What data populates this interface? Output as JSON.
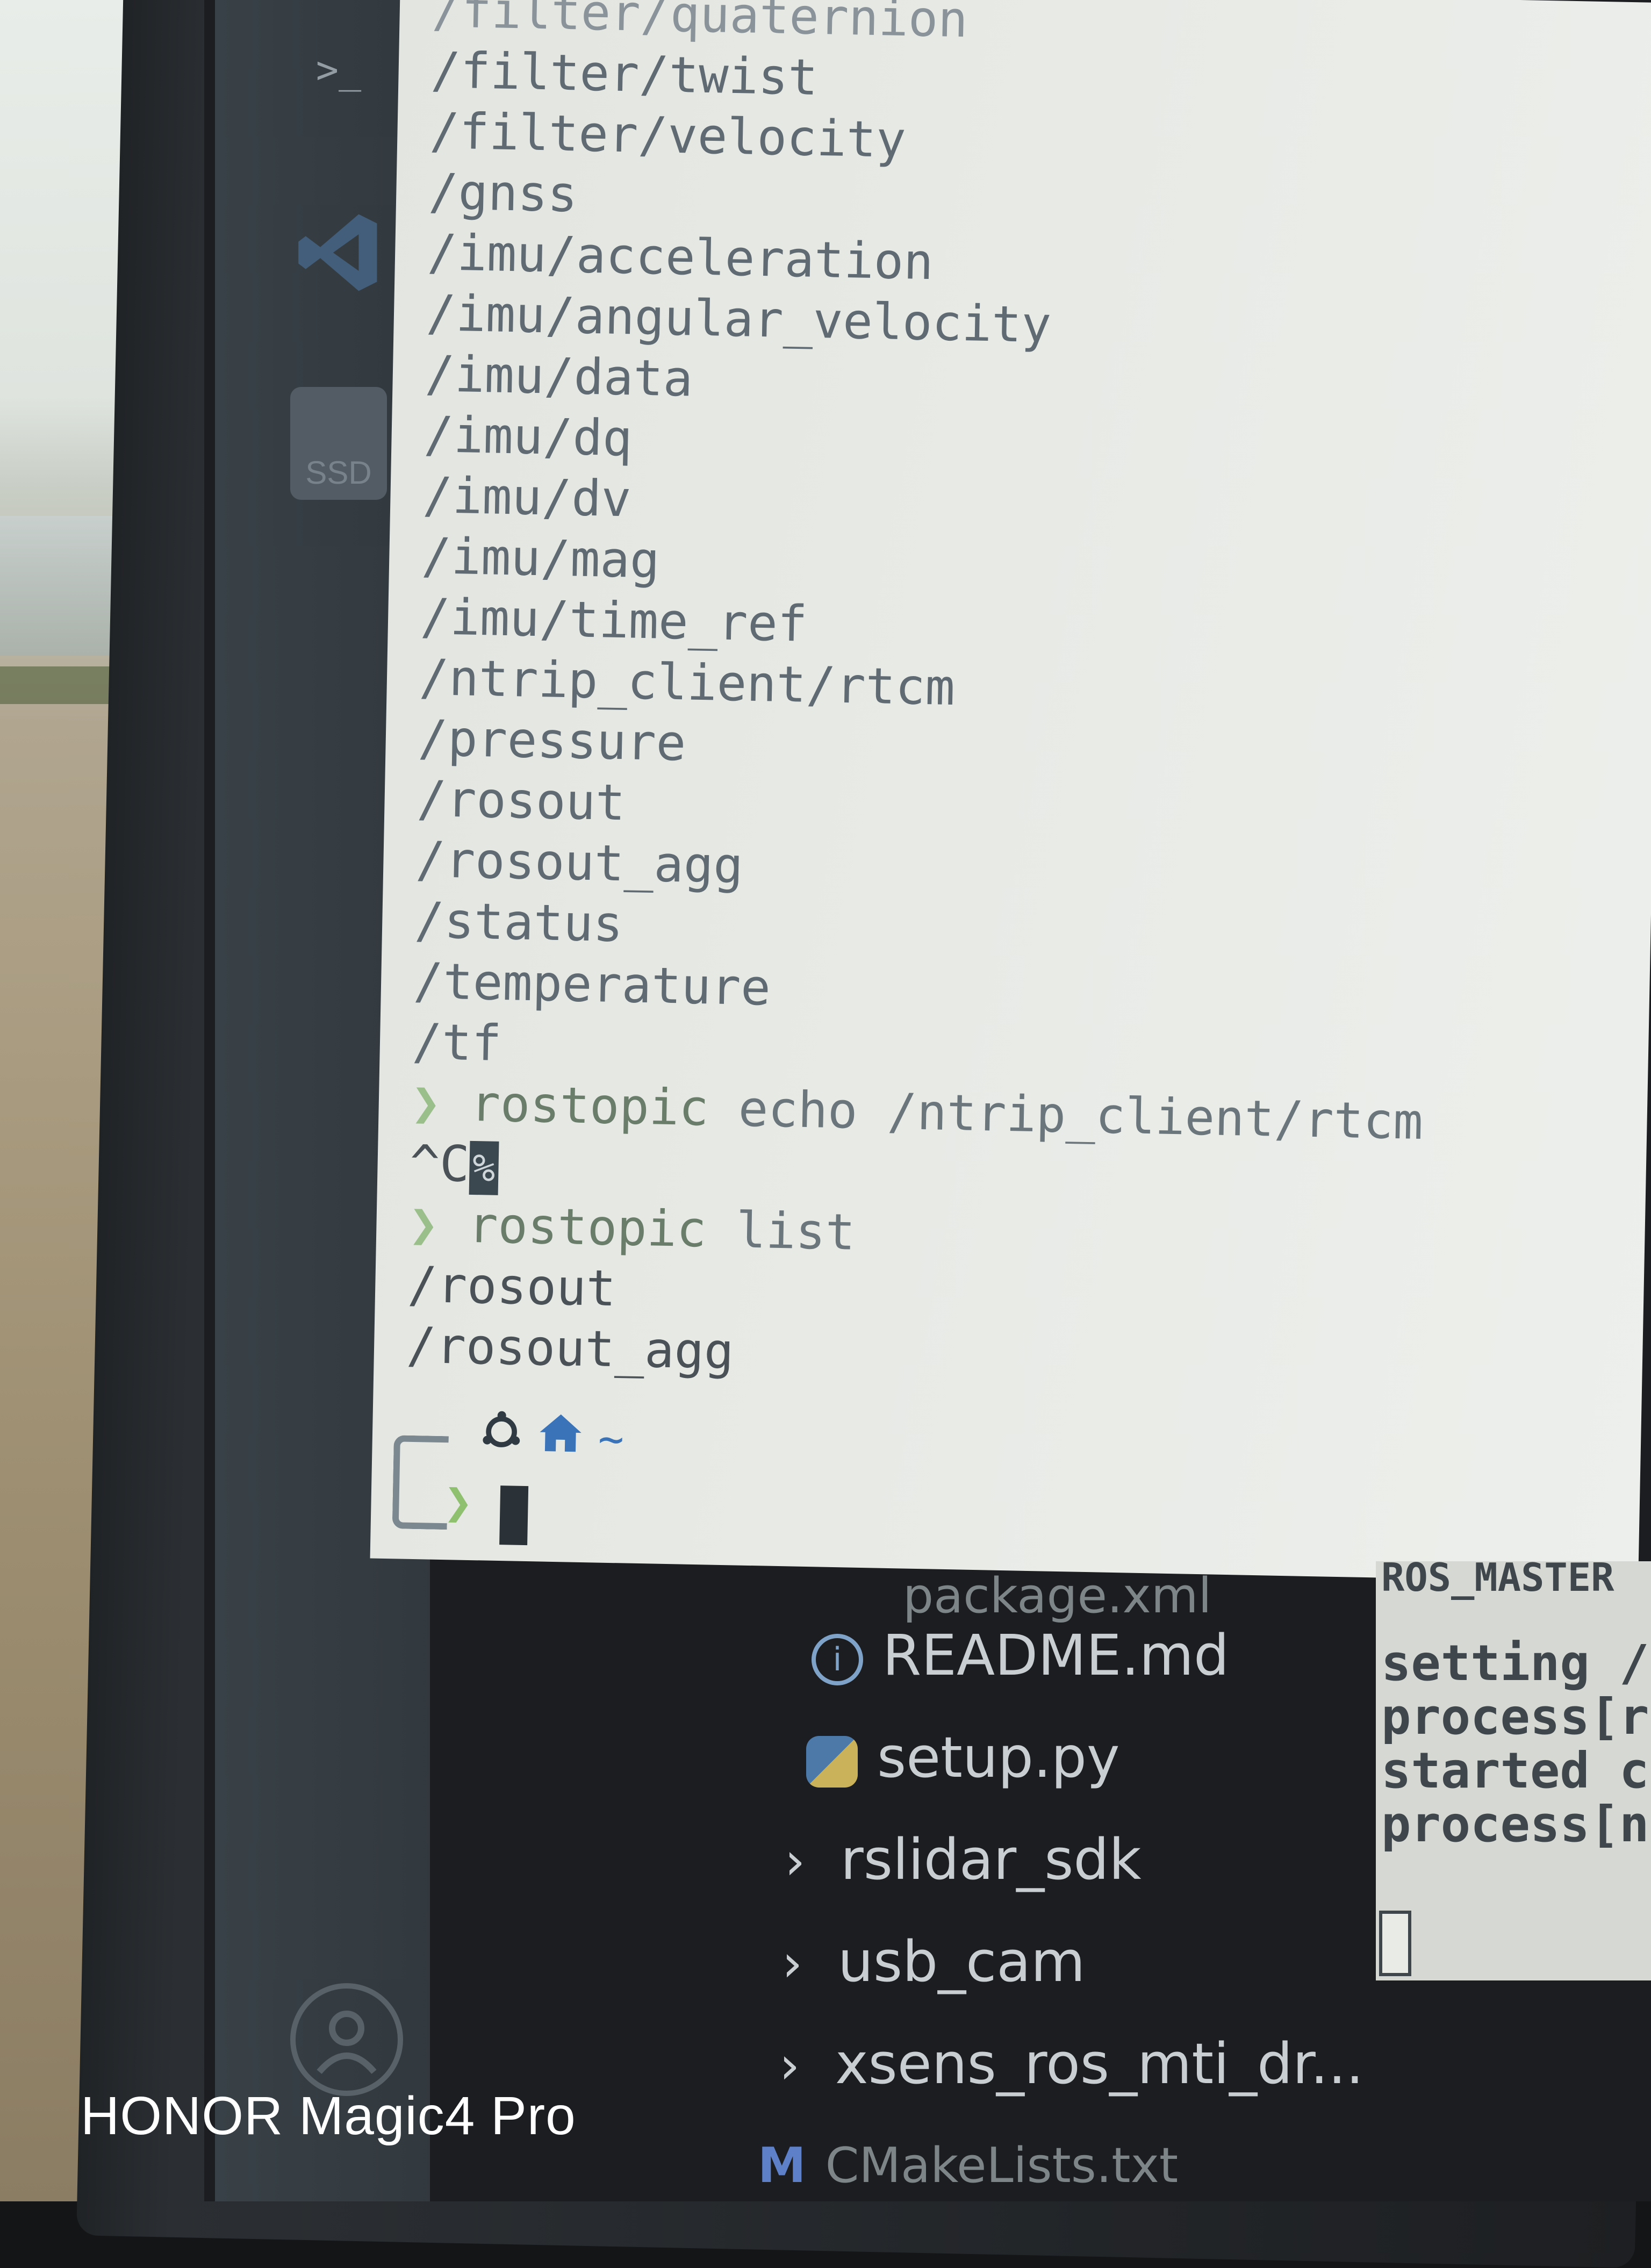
{
  "watermark": "HONOR Magic4 Pro",
  "dock": {
    "items": [
      "terminal-icon",
      "vscode-icon",
      "ssd-drive-icon",
      "user-avatar-icon"
    ],
    "terminal_glyph": ">_",
    "ssd_label": "SSD"
  },
  "terminal": {
    "lines": [
      "/filter/quaternion",
      "/filter/twist",
      "/filter/velocity",
      "/gnss",
      "/imu/acceleration",
      "/imu/angular_velocity",
      "/imu/data",
      "/imu/dq",
      "/imu/dv",
      "/imu/mag",
      "/imu/time_ref",
      "/ntrip_client/rtcm",
      "/pressure",
      "/rosout",
      "/rosout_agg",
      "/status",
      "/temperature",
      "/tf"
    ],
    "prompt_symbol": "❯",
    "cmd1": {
      "program": "rostopic",
      "args": "echo /ntrip_client/rtcm"
    },
    "interrupt": "^C",
    "interrupt_marker": "%",
    "cmd2": {
      "program": "rostopic",
      "args": "list"
    },
    "output2": [
      "/rosout",
      "/rosout_agg"
    ],
    "prompt_home": "~",
    "prompt_colors": {
      "arrow": "#8fc06f",
      "home": "#3a73b8"
    }
  },
  "explorer": {
    "faded_top": "package.xml",
    "items": [
      {
        "label": "README.md",
        "icon": "info-icon"
      },
      {
        "label": "setup.py",
        "icon": "python-icon"
      },
      {
        "label": "rslidar_sdk",
        "icon": "chevron-right-icon"
      },
      {
        "label": "usb_cam",
        "icon": "chevron-right-icon"
      },
      {
        "label": "xsens_ros_mti_dr...",
        "icon": "chevron-right-icon"
      },
      {
        "label": "CMakeLists.txt",
        "icon": "cmake-icon"
      }
    ]
  },
  "side_terminal": {
    "lines": [
      "ROS_MASTER",
      "",
      "setting /r",
      "process[ro",
      "started co",
      "process[nt"
    ]
  }
}
